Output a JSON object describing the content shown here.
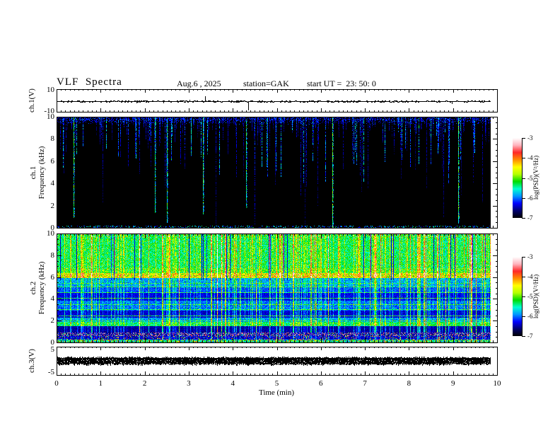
{
  "header": {
    "title": "VLF  Spectra",
    "date": "Aug.6 , 2025",
    "station": "station=GAK",
    "start_ut": "start UT =  23: 50: 0"
  },
  "axes": {
    "x": {
      "label": "Time  (min)",
      "ticks": [
        "0",
        "1",
        "2",
        "3",
        "4",
        "5",
        "6",
        "7",
        "8",
        "9",
        "10"
      ]
    },
    "panel1": {
      "ylabel": "ch.1(V)",
      "yticks": [
        "10",
        "-10"
      ]
    },
    "panel2": {
      "ylabel_line1": "ch.1",
      "ylabel_line2": "Frequency  (kHz)",
      "yticks": [
        "10",
        "8",
        "6",
        "4",
        "2",
        "0"
      ]
    },
    "panel3": {
      "ylabel_line1": "ch.2",
      "ylabel_line2": "Frequency  (kHz)",
      "yticks": [
        "10",
        "8",
        "6",
        "4",
        "2",
        "0"
      ]
    },
    "panel4": {
      "ylabel": "ch.3(V)",
      "yticks": [
        "5",
        "-5"
      ]
    },
    "colorbar": {
      "label": "log(PSD)(V²/Hz)",
      "ticks": [
        "-3",
        "-4",
        "-5",
        "-6",
        "-7"
      ]
    }
  },
  "chart_data": {
    "type": "heatmap",
    "title": "VLF Spectra",
    "date": "Aug.6 2025",
    "station": "GAK",
    "start_ut": "23:50:0",
    "xlabel": "Time (min)",
    "xlim": [
      0,
      10
    ],
    "record_length_min": 9.84,
    "colorbar": {
      "label": "log(PSD)(V^2/Hz)",
      "range_log_psd": [
        -7,
        -3
      ],
      "ticks": [
        -3,
        -4,
        -5,
        -6,
        -7
      ],
      "colormap_low_to_high": [
        "#000000",
        "#00006e",
        "#0000ff",
        "#0096ff",
        "#00ffd2",
        "#00dc00",
        "#b4ff00",
        "#ffff00",
        "#ff8c00",
        "#ff2828",
        "#ffb4be",
        "#ffffff"
      ]
    },
    "panels": [
      {
        "id": "ch1_voltage",
        "ylabel": "ch.1(V)",
        "ylim": [
          -10,
          10
        ],
        "yticks": [
          10,
          -10
        ],
        "description": "flat noisy waveform near 0 V with a few impulsive spikes",
        "noise_amp_v": 0.5,
        "spikes": [
          {
            "t_min": 1.8,
            "amp_v": -1.5
          },
          {
            "t_min": 2.4,
            "amp_v": -1.3
          },
          {
            "t_min": 3.0,
            "amp_v": 1.2
          },
          {
            "t_min": 3.35,
            "amp_v": 4.5
          },
          {
            "t_min": 4.33,
            "amp_v": -8.0
          },
          {
            "t_min": 8.95,
            "amp_v": -1.8
          }
        ]
      },
      {
        "id": "ch1_spectrogram",
        "ylabel": "ch.1 Frequency (kHz)",
        "ylim_khz": [
          0,
          10
        ],
        "yticks": [
          0,
          2,
          4,
          6,
          8,
          10
        ],
        "background_log_psd": -7,
        "description": "mostly quiet (black, -7) with vertical sferic streaks descending from 10 kHz; blue streaks of varying depth, a few bright cyan/green full-height streaks; faint active strip at the 0 kHz edge",
        "streaks": {
          "dim_count": 260,
          "medium_count": 45,
          "bright_full_height_t_min": [
            0.37,
            2.21,
            2.48,
            3.3,
            4.28,
            6.25,
            9.1
          ]
        }
      },
      {
        "id": "ch2_spectrogram",
        "ylabel": "ch.2 Frequency (kHz)",
        "ylim_khz": [
          0,
          10
        ],
        "yticks": [
          0,
          2,
          4,
          6,
          8,
          10
        ],
        "description": "intense broadband activity: green/cyan above ~7 kHz, bright yellow band ~6-6.5 kHz with red specks, blue 2-6 kHz with dark sub-bands and thin cyan horizontal lines, cyan band ~1.6-1.9 kHz, dark navy ~1-1.5 kHz, pink/red hiss lines ~0.6-0.95 kHz, colorful speckle near 0 kHz; many vertical green/yellow streaks and dark dropout columns",
        "bands": [
          {
            "f": [
              6.9,
              10.0
            ],
            "v": 0.48
          },
          {
            "f": [
              6.45,
              6.9
            ],
            "v": 0.52
          },
          {
            "f": [
              6.0,
              6.45
            ],
            "v": 0.64,
            "special": "yellow_band_red_specks"
          },
          {
            "f": [
              5.2,
              6.0
            ],
            "v": 0.34
          },
          {
            "f": [
              4.6,
              5.2
            ],
            "v": 0.28
          },
          {
            "f": [
              3.9,
              4.6
            ],
            "v": 0.2
          },
          {
            "f": [
              3.0,
              3.9
            ],
            "v": 0.3
          },
          {
            "f": [
              2.3,
              3.0
            ],
            "v": 0.18
          },
          {
            "f": [
              1.9,
              2.3
            ],
            "v": 0.33
          },
          {
            "f": [
              1.55,
              1.9
            ],
            "v": 0.46
          },
          {
            "f": [
              0.95,
              1.55
            ],
            "v": 0.14
          },
          {
            "f": [
              0.62,
              0.95
            ],
            "v": 0.12,
            "special": "pink"
          },
          {
            "f": [
              0.3,
              0.62
            ],
            "v": 0.18,
            "special": "specks"
          },
          {
            "f": [
              0.0,
              0.3
            ],
            "v": 0.4,
            "special": "bottom"
          }
        ],
        "hlines_khz": [
          1.75,
          2.05,
          2.5,
          3.05,
          3.55,
          4.1,
          4.65,
          5.15,
          5.5
        ],
        "vstreaks": {
          "count": 210,
          "bright_count": 45,
          "dark_gap_count": 28
        }
      },
      {
        "id": "ch3_voltage",
        "ylabel": "ch.3(V)",
        "ylim": [
          -5,
          5
        ],
        "yticks": [
          5,
          -5
        ],
        "description": "saturated dense signal forming a solid black band around 0 V",
        "band_v": [
          -1.0,
          0.9
        ]
      }
    ]
  }
}
